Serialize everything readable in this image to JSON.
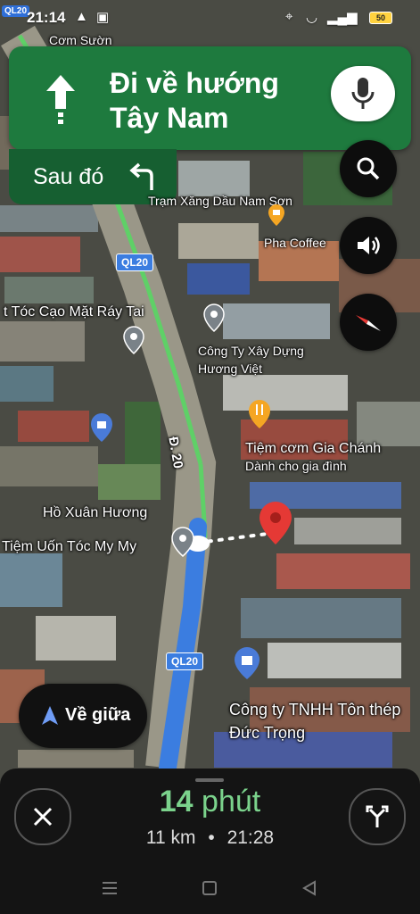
{
  "status_bar": {
    "time": "21:14",
    "battery": "50",
    "road_badge": "QL20"
  },
  "top_label": "Cơm Sườn",
  "navigation": {
    "instruction": "Đi về hướng Tây Nam",
    "then_label": "Sau đó"
  },
  "map_labels": {
    "gas_station": "Trạm Xăng Dầu Nam Sơn",
    "pha_coffee": "Pha Coffee",
    "ql20_top": "QL20",
    "barber": "t Tóc Cạo Mặt Ráy Tai",
    "cong_ty_xay_dung": "Công Ty Xây Dựng Hương Việt",
    "d20": "Đ. 20",
    "tiem_com": "Tiệm cơm Gia Chánh",
    "tiem_com_sub": "Dành cho gia đình",
    "ho_xuan_huong": "Hồ Xuân Hương",
    "tiem_uon_toc": "Tiệm Uốn Tóc My My",
    "ql20_bottom": "QL20",
    "cong_ty_ton_thep": "Công ty TNHH Tôn thép Đức Trọng"
  },
  "recenter_label": "Về giữa",
  "eta": {
    "minutes": "14",
    "unit": "phút",
    "distance": "11 km",
    "separator": "•",
    "arrival": "21:28"
  },
  "icons": [
    "mic-icon",
    "search-icon",
    "volume-icon",
    "compass-icon",
    "close-icon",
    "alternate-routes-icon",
    "recenter-arrow-icon"
  ],
  "colors": {
    "nav_green": "#1e7a3e",
    "then_green": "#165f31",
    "eta_green": "#7bd38c",
    "route_blue": "#3b7de0"
  }
}
